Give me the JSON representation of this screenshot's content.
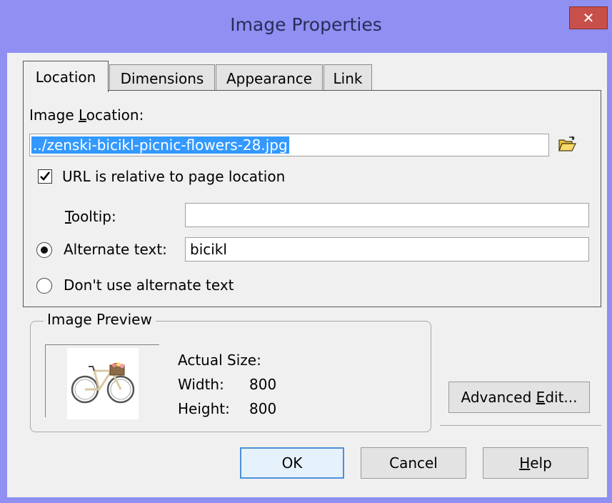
{
  "window": {
    "title": "Image Properties",
    "close_glyph": "✕"
  },
  "tabs": [
    {
      "label": "Location",
      "active": true
    },
    {
      "label": "Dimensions",
      "active": false
    },
    {
      "label": "Appearance",
      "active": false
    },
    {
      "label": "Link",
      "active": false
    }
  ],
  "location": {
    "image_location_label_pre": "Image ",
    "image_location_label_u": "L",
    "image_location_label_post": "ocation:",
    "image_location_value": "../zenski-bicikl-picnic-flowers-28.jpg",
    "browse_icon": "folder-open-icon",
    "relative_checkbox_label": "URL is relative to page location",
    "relative_checked": true,
    "tooltip_label_u": "T",
    "tooltip_label_rest": "ooltip:",
    "tooltip_value": "",
    "alt_text_label": "Alternate text:",
    "alt_text_value": "bicikl",
    "no_alt_label": "Don't use alternate text",
    "alt_selected": true
  },
  "preview": {
    "group_title": "Image Preview",
    "actual_size_label": "Actual Size:",
    "width_label": "Width:",
    "width_value": "800",
    "height_label": "Height:",
    "height_value": "800",
    "image_icon": "bicycle-image"
  },
  "buttons": {
    "advanced_edit_pre": "Advanced ",
    "advanced_edit_u": "E",
    "advanced_edit_post": "dit...",
    "ok": "OK",
    "cancel": "Cancel",
    "help_u": "H",
    "help_rest": "elp"
  },
  "colors": {
    "titlebar": "#8f90f2",
    "close": "#c7504a",
    "selection": "#3399ff",
    "default_button_border": "#4a90d9"
  }
}
